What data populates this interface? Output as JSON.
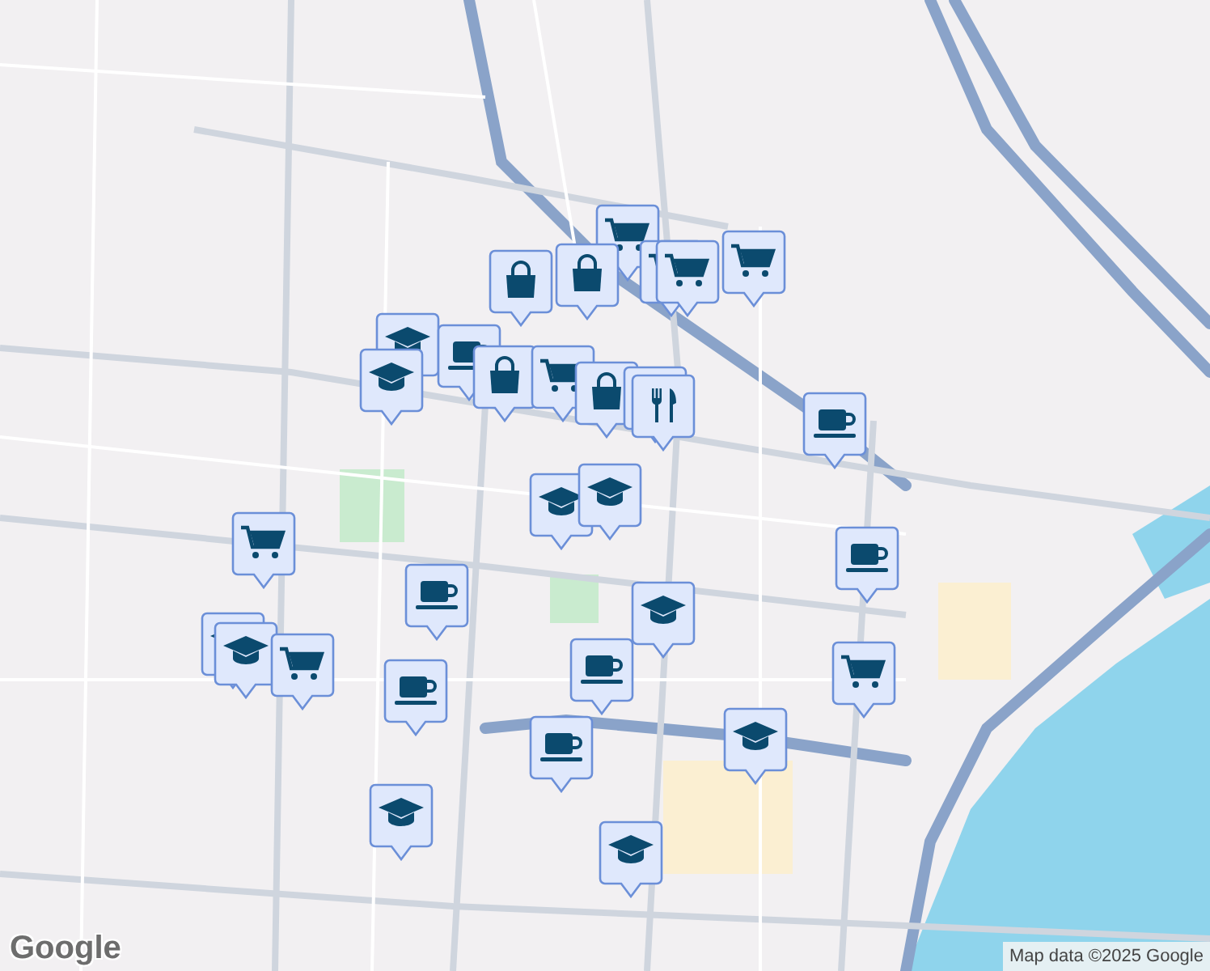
{
  "map": {
    "markers": [
      {
        "kind": "grocery"
      },
      {
        "kind": "shop"
      },
      {
        "kind": "grocery"
      },
      {
        "kind": "grocery"
      },
      {
        "kind": "grocery"
      },
      {
        "kind": "school"
      },
      {
        "kind": "school"
      },
      {
        "kind": "shop"
      },
      {
        "kind": "cafe"
      },
      {
        "kind": "shop"
      },
      {
        "kind": "grocery"
      },
      {
        "kind": "shop"
      },
      {
        "kind": "restaurant"
      },
      {
        "kind": "restaurant"
      },
      {
        "kind": "cafe"
      },
      {
        "kind": "school"
      },
      {
        "kind": "school"
      },
      {
        "kind": "grocery"
      },
      {
        "kind": "cafe"
      },
      {
        "kind": "cafe"
      },
      {
        "kind": "school"
      },
      {
        "kind": "school"
      },
      {
        "kind": "school"
      },
      {
        "kind": "grocery"
      },
      {
        "kind": "cafe"
      },
      {
        "kind": "grocery"
      },
      {
        "kind": "cafe"
      },
      {
        "kind": "cafe"
      },
      {
        "kind": "school"
      },
      {
        "kind": "school"
      },
      {
        "kind": "school"
      }
    ]
  },
  "logo": "Google",
  "attribution": "Map data ©2025 Google"
}
